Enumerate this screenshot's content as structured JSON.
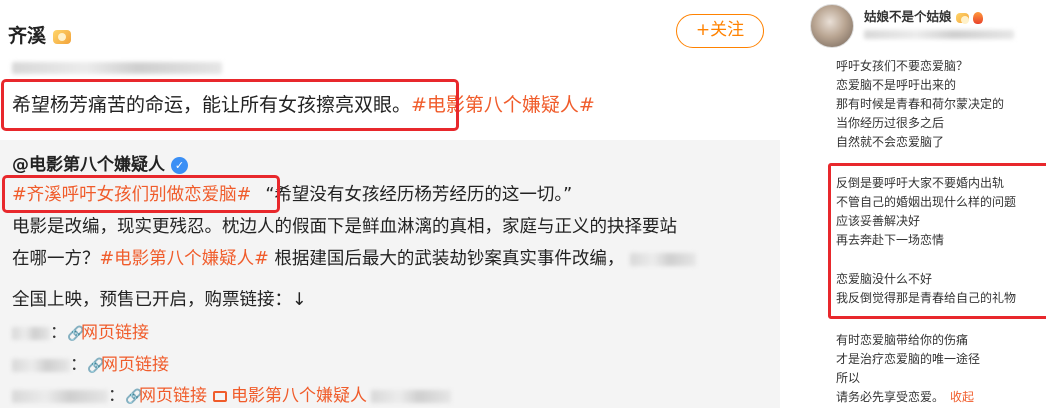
{
  "post": {
    "username": "齐溪",
    "follow_label": "+关注",
    "text": "希望杨芳痛苦的命运，能让所有女孩擦亮双眼。",
    "topic": "#电影第八个嫌疑人#"
  },
  "repost": {
    "author": "@电影第八个嫌疑人",
    "topic_highlight": "#齐溪呼吁女孩们别做恋爱脑#",
    "quote": "“希望没有女孩经历杨芳经历的这一切。”",
    "line2": "电影是改编，现实更残忍。枕边人的假面下是鲜血淋漓的真相，家庭与正义的抉择要站",
    "line3_prefix": "在哪一方？",
    "line3_topic": "#电影第八个嫌疑人#",
    "line3_suffix": " 根据建国后最大的武装劫钞案真实事件改编，",
    "line4": "全国上映，预售已开启，购票链接：↓",
    "links": [
      {
        "separator": "：",
        "label": "网页链接"
      },
      {
        "separator": "：",
        "label": "网页链接"
      },
      {
        "separator": "：",
        "label": "网页链接",
        "extra": "电影第八个嫌疑人"
      }
    ]
  },
  "comment": {
    "username": "姑娘不是个姑娘",
    "lines_a": [
      "呼吁女孩们不要恋爱脑？",
      "恋爱脑不是呼吁出来的",
      "那有时候是青春和荷尔蒙决定的",
      "当你经历过很多之后",
      "自然就不会恋爱脑了"
    ],
    "lines_b": [
      "反倒是要呼吁大家不要婚内出轨",
      "不管自己的婚姻出现什么样的问题",
      "应该妥善解决好",
      "再去奔赴下一场恋情"
    ],
    "lines_c": [
      "恋爱脑没什么不好",
      "我反倒觉得那是青春给自己的礼物"
    ],
    "lines_d": [
      "有时恋爱脑带给你的伤痛",
      "才是治疗恋爱脑的唯一途径",
      "所以"
    ],
    "last_line": "请务必先享受恋爱。",
    "collapse_label": "收起"
  },
  "colors": {
    "highlight_box": "#e8282c",
    "topic": "#f05c2b",
    "follow": "#ff8200",
    "verified": "#3b8ff5"
  }
}
